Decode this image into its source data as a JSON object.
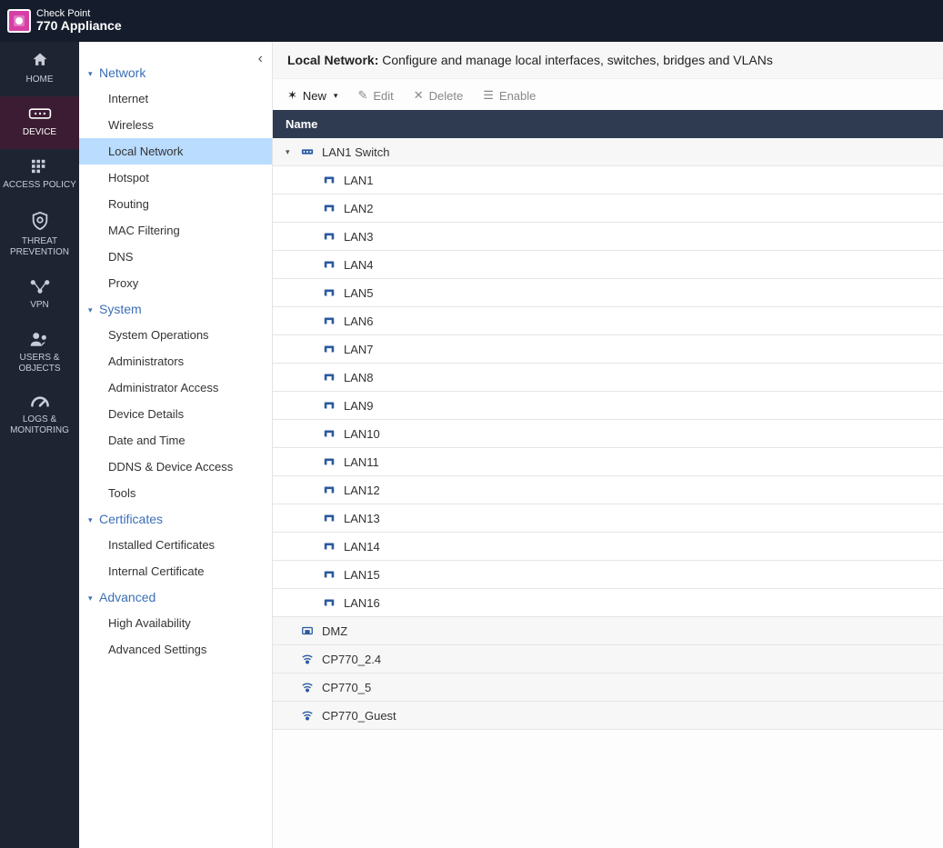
{
  "brand": {
    "top": "Check Point",
    "bottom": "770 Appliance"
  },
  "nav": [
    {
      "id": "home",
      "label": "HOME"
    },
    {
      "id": "device",
      "label": "DEVICE",
      "active": true
    },
    {
      "id": "access",
      "label": "ACCESS POLICY"
    },
    {
      "id": "threat",
      "label": "THREAT PREVENTION"
    },
    {
      "id": "vpn",
      "label": "VPN"
    },
    {
      "id": "users",
      "label": "USERS & OBJECTS"
    },
    {
      "id": "logs",
      "label": "LOGS & MONITORING"
    }
  ],
  "subnav": [
    {
      "type": "group",
      "label": "Network"
    },
    {
      "type": "item",
      "label": "Internet"
    },
    {
      "type": "item",
      "label": "Wireless"
    },
    {
      "type": "item",
      "label": "Local Network",
      "selected": true
    },
    {
      "type": "item",
      "label": "Hotspot"
    },
    {
      "type": "item",
      "label": "Routing"
    },
    {
      "type": "item",
      "label": "MAC Filtering"
    },
    {
      "type": "item",
      "label": "DNS"
    },
    {
      "type": "item",
      "label": "Proxy"
    },
    {
      "type": "group",
      "label": "System"
    },
    {
      "type": "item",
      "label": "System Operations"
    },
    {
      "type": "item",
      "label": "Administrators"
    },
    {
      "type": "item",
      "label": "Administrator Access"
    },
    {
      "type": "item",
      "label": "Device Details"
    },
    {
      "type": "item",
      "label": "Date and Time"
    },
    {
      "type": "item",
      "label": "DDNS & Device Access"
    },
    {
      "type": "item",
      "label": "Tools"
    },
    {
      "type": "group",
      "label": "Certificates"
    },
    {
      "type": "item",
      "label": "Installed Certificates"
    },
    {
      "type": "item",
      "label": "Internal Certificate"
    },
    {
      "type": "group",
      "label": "Advanced"
    },
    {
      "type": "item",
      "label": "High Availability"
    },
    {
      "type": "item",
      "label": "Advanced Settings"
    }
  ],
  "page": {
    "title": "Local Network:",
    "subtitle": "Configure and manage local interfaces, switches, bridges and VLANs"
  },
  "toolbar": {
    "new": "New",
    "edit": "Edit",
    "delete": "Delete",
    "enable": "Enable"
  },
  "table": {
    "header": "Name",
    "rows": [
      {
        "kind": "switch",
        "label": "LAN1 Switch"
      },
      {
        "kind": "port",
        "label": "LAN1"
      },
      {
        "kind": "port",
        "label": "LAN2"
      },
      {
        "kind": "port",
        "label": "LAN3"
      },
      {
        "kind": "port",
        "label": "LAN4"
      },
      {
        "kind": "port",
        "label": "LAN5"
      },
      {
        "kind": "port",
        "label": "LAN6"
      },
      {
        "kind": "port",
        "label": "LAN7"
      },
      {
        "kind": "port",
        "label": "LAN8"
      },
      {
        "kind": "port",
        "label": "LAN9"
      },
      {
        "kind": "port",
        "label": "LAN10"
      },
      {
        "kind": "port",
        "label": "LAN11"
      },
      {
        "kind": "port",
        "label": "LAN12"
      },
      {
        "kind": "port",
        "label": "LAN13"
      },
      {
        "kind": "port",
        "label": "LAN14"
      },
      {
        "kind": "port",
        "label": "LAN15"
      },
      {
        "kind": "port",
        "label": "LAN16"
      },
      {
        "kind": "dmz",
        "label": "DMZ"
      },
      {
        "kind": "wifi",
        "label": "CP770_2.4"
      },
      {
        "kind": "wifi",
        "label": "CP770_5"
      },
      {
        "kind": "wifi",
        "label": "CP770_Guest"
      }
    ]
  }
}
